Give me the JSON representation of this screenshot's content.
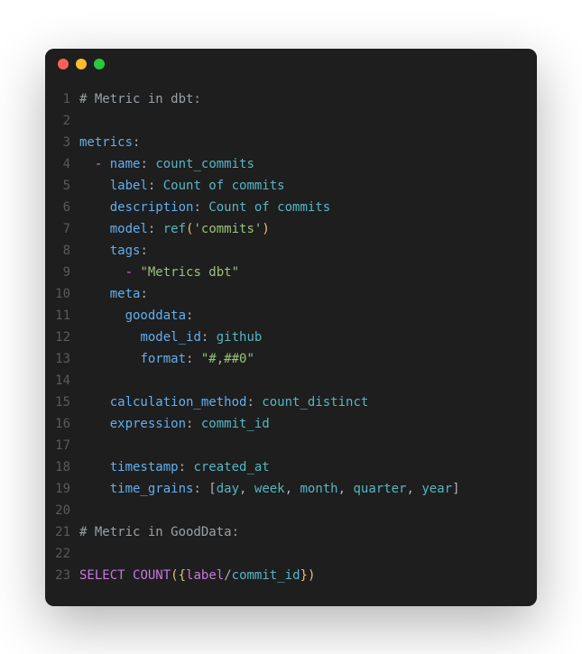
{
  "titlebar": {
    "dots": [
      "close",
      "minimize",
      "maximize"
    ]
  },
  "code": {
    "lines": [
      {
        "n": "1",
        "tokens": [
          {
            "c": "comment",
            "t": "# Metric in dbt:"
          }
        ]
      },
      {
        "n": "2",
        "tokens": []
      },
      {
        "n": "3",
        "tokens": [
          {
            "c": "key",
            "t": "metrics"
          },
          {
            "c": "punct",
            "t": ":"
          }
        ]
      },
      {
        "n": "4",
        "tokens": [
          {
            "c": "punct",
            "t": "  "
          },
          {
            "c": "dash",
            "t": "-"
          },
          {
            "c": "punct",
            "t": " "
          },
          {
            "c": "key",
            "t": "name"
          },
          {
            "c": "punct",
            "t": ": "
          },
          {
            "c": "value",
            "t": "count_commits"
          }
        ]
      },
      {
        "n": "5",
        "tokens": [
          {
            "c": "punct",
            "t": "    "
          },
          {
            "c": "key",
            "t": "label"
          },
          {
            "c": "punct",
            "t": ": "
          },
          {
            "c": "value",
            "t": "Count of commits"
          }
        ]
      },
      {
        "n": "6",
        "tokens": [
          {
            "c": "punct",
            "t": "    "
          },
          {
            "c": "key",
            "t": "description"
          },
          {
            "c": "punct",
            "t": ": "
          },
          {
            "c": "value",
            "t": "Count of commits"
          }
        ]
      },
      {
        "n": "7",
        "tokens": [
          {
            "c": "punct",
            "t": "    "
          },
          {
            "c": "key",
            "t": "model"
          },
          {
            "c": "punct",
            "t": ": "
          },
          {
            "c": "func",
            "t": "ref"
          },
          {
            "c": "paren",
            "t": "("
          },
          {
            "c": "string",
            "t": "'commits'"
          },
          {
            "c": "paren",
            "t": ")"
          }
        ]
      },
      {
        "n": "8",
        "tokens": [
          {
            "c": "punct",
            "t": "    "
          },
          {
            "c": "key",
            "t": "tags"
          },
          {
            "c": "punct",
            "t": ":"
          }
        ]
      },
      {
        "n": "9",
        "tokens": [
          {
            "c": "punct",
            "t": "      "
          },
          {
            "c": "dash",
            "t": "-"
          },
          {
            "c": "punct",
            "t": " "
          },
          {
            "c": "string",
            "t": "\"Metrics dbt\""
          }
        ]
      },
      {
        "n": "10",
        "tokens": [
          {
            "c": "punct",
            "t": "    "
          },
          {
            "c": "key",
            "t": "meta"
          },
          {
            "c": "punct",
            "t": ":"
          }
        ]
      },
      {
        "n": "11",
        "tokens": [
          {
            "c": "punct",
            "t": "      "
          },
          {
            "c": "key",
            "t": "gooddata"
          },
          {
            "c": "punct",
            "t": ":"
          }
        ]
      },
      {
        "n": "12",
        "tokens": [
          {
            "c": "punct",
            "t": "        "
          },
          {
            "c": "key",
            "t": "model_id"
          },
          {
            "c": "punct",
            "t": ": "
          },
          {
            "c": "value",
            "t": "github"
          }
        ]
      },
      {
        "n": "13",
        "tokens": [
          {
            "c": "punct",
            "t": "        "
          },
          {
            "c": "key",
            "t": "format"
          },
          {
            "c": "punct",
            "t": ": "
          },
          {
            "c": "string",
            "t": "\"#,##0\""
          }
        ]
      },
      {
        "n": "14",
        "tokens": []
      },
      {
        "n": "15",
        "tokens": [
          {
            "c": "punct",
            "t": "    "
          },
          {
            "c": "key",
            "t": "calculation_method"
          },
          {
            "c": "punct",
            "t": ": "
          },
          {
            "c": "value",
            "t": "count_distinct"
          }
        ]
      },
      {
        "n": "16",
        "tokens": [
          {
            "c": "punct",
            "t": "    "
          },
          {
            "c": "key",
            "t": "expression"
          },
          {
            "c": "punct",
            "t": ": "
          },
          {
            "c": "value",
            "t": "commit_id"
          }
        ]
      },
      {
        "n": "17",
        "tokens": []
      },
      {
        "n": "18",
        "tokens": [
          {
            "c": "punct",
            "t": "    "
          },
          {
            "c": "key",
            "t": "timestamp"
          },
          {
            "c": "punct",
            "t": ": "
          },
          {
            "c": "value",
            "t": "created_at"
          }
        ]
      },
      {
        "n": "19",
        "tokens": [
          {
            "c": "punct",
            "t": "    "
          },
          {
            "c": "key",
            "t": "time_grains"
          },
          {
            "c": "punct",
            "t": ": ["
          },
          {
            "c": "value",
            "t": "day"
          },
          {
            "c": "punct",
            "t": ", "
          },
          {
            "c": "value",
            "t": "week"
          },
          {
            "c": "punct",
            "t": ", "
          },
          {
            "c": "value",
            "t": "month"
          },
          {
            "c": "punct",
            "t": ", "
          },
          {
            "c": "value",
            "t": "quarter"
          },
          {
            "c": "punct",
            "t": ", "
          },
          {
            "c": "value",
            "t": "year"
          },
          {
            "c": "punct",
            "t": "]"
          }
        ]
      },
      {
        "n": "20",
        "tokens": []
      },
      {
        "n": "21",
        "tokens": [
          {
            "c": "comment",
            "t": "# Metric in GoodData:"
          }
        ]
      },
      {
        "n": "22",
        "tokens": []
      },
      {
        "n": "23",
        "tokens": [
          {
            "c": "kw",
            "t": "SELECT"
          },
          {
            "c": "punct",
            "t": " "
          },
          {
            "c": "kw",
            "t": "COUNT"
          },
          {
            "c": "paren",
            "t": "("
          },
          {
            "c": "brace",
            "t": "{"
          },
          {
            "c": "ident",
            "t": "label"
          },
          {
            "c": "slash",
            "t": "/"
          },
          {
            "c": "ident2",
            "t": "commit_id"
          },
          {
            "c": "brace",
            "t": "}"
          },
          {
            "c": "paren",
            "t": ")"
          }
        ]
      }
    ]
  }
}
